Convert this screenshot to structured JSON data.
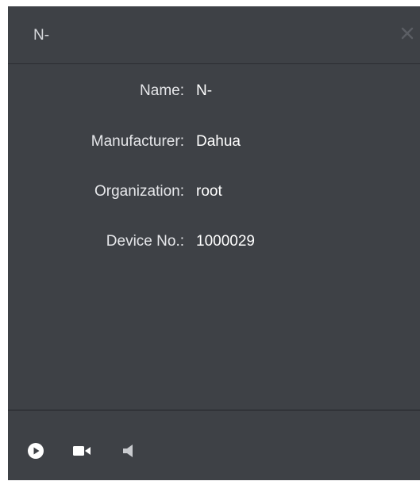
{
  "window": {
    "title": "N-",
    "close_icon": "close-icon"
  },
  "details": [
    {
      "label": "Name:",
      "value": "N-"
    },
    {
      "label": "Manufacturer:",
      "value": "Dahua"
    },
    {
      "label": "Organization:",
      "value": "root"
    },
    {
      "label": "Device No.:",
      "value": "1000029"
    }
  ],
  "toolbar": {
    "icons": [
      "play-icon",
      "camera-icon",
      "speaker-icon"
    ]
  },
  "colors": {
    "panel_background": "#3e4146",
    "text": "#ffffff"
  }
}
